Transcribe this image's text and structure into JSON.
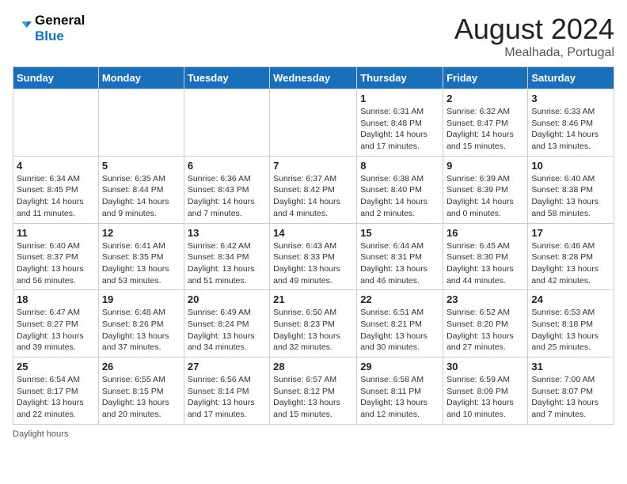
{
  "header": {
    "logo_line1": "General",
    "logo_line2": "Blue",
    "month": "August 2024",
    "location": "Mealhada, Portugal"
  },
  "weekdays": [
    "Sunday",
    "Monday",
    "Tuesday",
    "Wednesday",
    "Thursday",
    "Friday",
    "Saturday"
  ],
  "weeks": [
    [
      {
        "day": "",
        "info": ""
      },
      {
        "day": "",
        "info": ""
      },
      {
        "day": "",
        "info": ""
      },
      {
        "day": "",
        "info": ""
      },
      {
        "day": "1",
        "info": "Sunrise: 6:31 AM\nSunset: 8:48 PM\nDaylight: 14 hours and 17 minutes."
      },
      {
        "day": "2",
        "info": "Sunrise: 6:32 AM\nSunset: 8:47 PM\nDaylight: 14 hours and 15 minutes."
      },
      {
        "day": "3",
        "info": "Sunrise: 6:33 AM\nSunset: 8:46 PM\nDaylight: 14 hours and 13 minutes."
      }
    ],
    [
      {
        "day": "4",
        "info": "Sunrise: 6:34 AM\nSunset: 8:45 PM\nDaylight: 14 hours and 11 minutes."
      },
      {
        "day": "5",
        "info": "Sunrise: 6:35 AM\nSunset: 8:44 PM\nDaylight: 14 hours and 9 minutes."
      },
      {
        "day": "6",
        "info": "Sunrise: 6:36 AM\nSunset: 8:43 PM\nDaylight: 14 hours and 7 minutes."
      },
      {
        "day": "7",
        "info": "Sunrise: 6:37 AM\nSunset: 8:42 PM\nDaylight: 14 hours and 4 minutes."
      },
      {
        "day": "8",
        "info": "Sunrise: 6:38 AM\nSunset: 8:40 PM\nDaylight: 14 hours and 2 minutes."
      },
      {
        "day": "9",
        "info": "Sunrise: 6:39 AM\nSunset: 8:39 PM\nDaylight: 14 hours and 0 minutes."
      },
      {
        "day": "10",
        "info": "Sunrise: 6:40 AM\nSunset: 8:38 PM\nDaylight: 13 hours and 58 minutes."
      }
    ],
    [
      {
        "day": "11",
        "info": "Sunrise: 6:40 AM\nSunset: 8:37 PM\nDaylight: 13 hours and 56 minutes."
      },
      {
        "day": "12",
        "info": "Sunrise: 6:41 AM\nSunset: 8:35 PM\nDaylight: 13 hours and 53 minutes."
      },
      {
        "day": "13",
        "info": "Sunrise: 6:42 AM\nSunset: 8:34 PM\nDaylight: 13 hours and 51 minutes."
      },
      {
        "day": "14",
        "info": "Sunrise: 6:43 AM\nSunset: 8:33 PM\nDaylight: 13 hours and 49 minutes."
      },
      {
        "day": "15",
        "info": "Sunrise: 6:44 AM\nSunset: 8:31 PM\nDaylight: 13 hours and 46 minutes."
      },
      {
        "day": "16",
        "info": "Sunrise: 6:45 AM\nSunset: 8:30 PM\nDaylight: 13 hours and 44 minutes."
      },
      {
        "day": "17",
        "info": "Sunrise: 6:46 AM\nSunset: 8:28 PM\nDaylight: 13 hours and 42 minutes."
      }
    ],
    [
      {
        "day": "18",
        "info": "Sunrise: 6:47 AM\nSunset: 8:27 PM\nDaylight: 13 hours and 39 minutes."
      },
      {
        "day": "19",
        "info": "Sunrise: 6:48 AM\nSunset: 8:26 PM\nDaylight: 13 hours and 37 minutes."
      },
      {
        "day": "20",
        "info": "Sunrise: 6:49 AM\nSunset: 8:24 PM\nDaylight: 13 hours and 34 minutes."
      },
      {
        "day": "21",
        "info": "Sunrise: 6:50 AM\nSunset: 8:23 PM\nDaylight: 13 hours and 32 minutes."
      },
      {
        "day": "22",
        "info": "Sunrise: 6:51 AM\nSunset: 8:21 PM\nDaylight: 13 hours and 30 minutes."
      },
      {
        "day": "23",
        "info": "Sunrise: 6:52 AM\nSunset: 8:20 PM\nDaylight: 13 hours and 27 minutes."
      },
      {
        "day": "24",
        "info": "Sunrise: 6:53 AM\nSunset: 8:18 PM\nDaylight: 13 hours and 25 minutes."
      }
    ],
    [
      {
        "day": "25",
        "info": "Sunrise: 6:54 AM\nSunset: 8:17 PM\nDaylight: 13 hours and 22 minutes."
      },
      {
        "day": "26",
        "info": "Sunrise: 6:55 AM\nSunset: 8:15 PM\nDaylight: 13 hours and 20 minutes."
      },
      {
        "day": "27",
        "info": "Sunrise: 6:56 AM\nSunset: 8:14 PM\nDaylight: 13 hours and 17 minutes."
      },
      {
        "day": "28",
        "info": "Sunrise: 6:57 AM\nSunset: 8:12 PM\nDaylight: 13 hours and 15 minutes."
      },
      {
        "day": "29",
        "info": "Sunrise: 6:58 AM\nSunset: 8:11 PM\nDaylight: 13 hours and 12 minutes."
      },
      {
        "day": "30",
        "info": "Sunrise: 6:59 AM\nSunset: 8:09 PM\nDaylight: 13 hours and 10 minutes."
      },
      {
        "day": "31",
        "info": "Sunrise: 7:00 AM\nSunset: 8:07 PM\nDaylight: 13 hours and 7 minutes."
      }
    ]
  ],
  "footer": "Daylight hours"
}
